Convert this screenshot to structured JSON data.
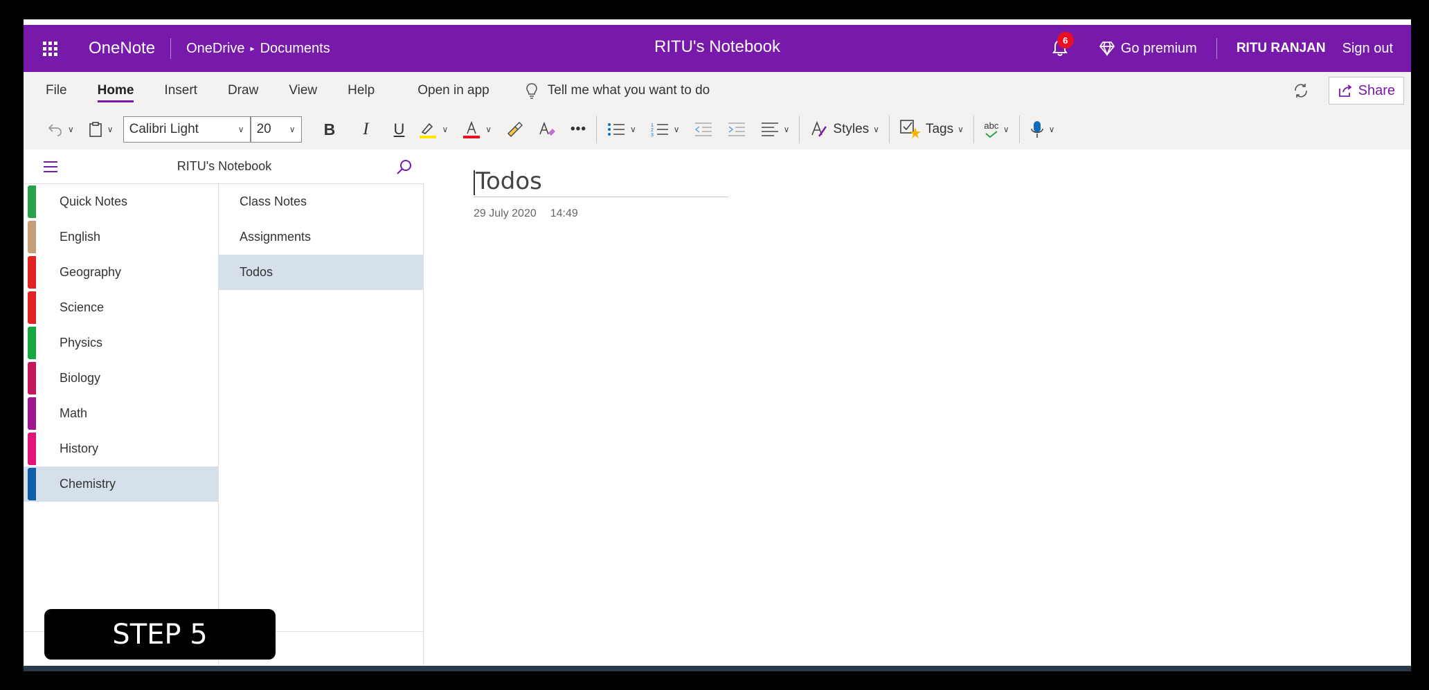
{
  "titlebar": {
    "app_name": "OneNote",
    "breadcrumb_1": "OneDrive",
    "breadcrumb_2": "Documents",
    "notebook_title": "RITU's Notebook",
    "notification_count": "6",
    "premium_label": "Go premium",
    "user_name": "RITU RANJAN",
    "signout_label": "Sign out"
  },
  "menu": {
    "tabs": [
      "File",
      "Home",
      "Insert",
      "Draw",
      "View",
      "Help",
      "Open in app"
    ],
    "active_tab": "Home",
    "tellme_placeholder": "Tell me what you want to do",
    "share_label": "Share"
  },
  "ribbon": {
    "font_name": "Calibri Light",
    "font_size": "20",
    "bold": "B",
    "italic": "I",
    "underline": "U",
    "more": "•••",
    "styles_label": "Styles",
    "tags_label": "Tags",
    "spell_label": "abc"
  },
  "nav": {
    "notebook_name": "RITU's Notebook",
    "sections": [
      {
        "label": "Quick Notes",
        "color": "#2AA14B"
      },
      {
        "label": "English",
        "color": "#C4A07A"
      },
      {
        "label": "Geography",
        "color": "#E02424"
      },
      {
        "label": "Science",
        "color": "#E02424"
      },
      {
        "label": "Physics",
        "color": "#17A843"
      },
      {
        "label": "Biology",
        "color": "#C4185C"
      },
      {
        "label": "Math",
        "color": "#A0168E"
      },
      {
        "label": "History",
        "color": "#E0167A"
      },
      {
        "label": "Chemistry",
        "color": "#0F5FA8"
      }
    ],
    "selected_section": "Chemistry",
    "pages": [
      "Class Notes",
      "Assignments",
      "Todos"
    ],
    "selected_page": "Todos"
  },
  "page": {
    "title": "Todos",
    "date": "29 July 2020",
    "time": "14:49"
  },
  "overlay": {
    "step_label": "STEP 5"
  },
  "colors": {
    "brand": "#7719AA",
    "selection": "#D6E0EA"
  }
}
